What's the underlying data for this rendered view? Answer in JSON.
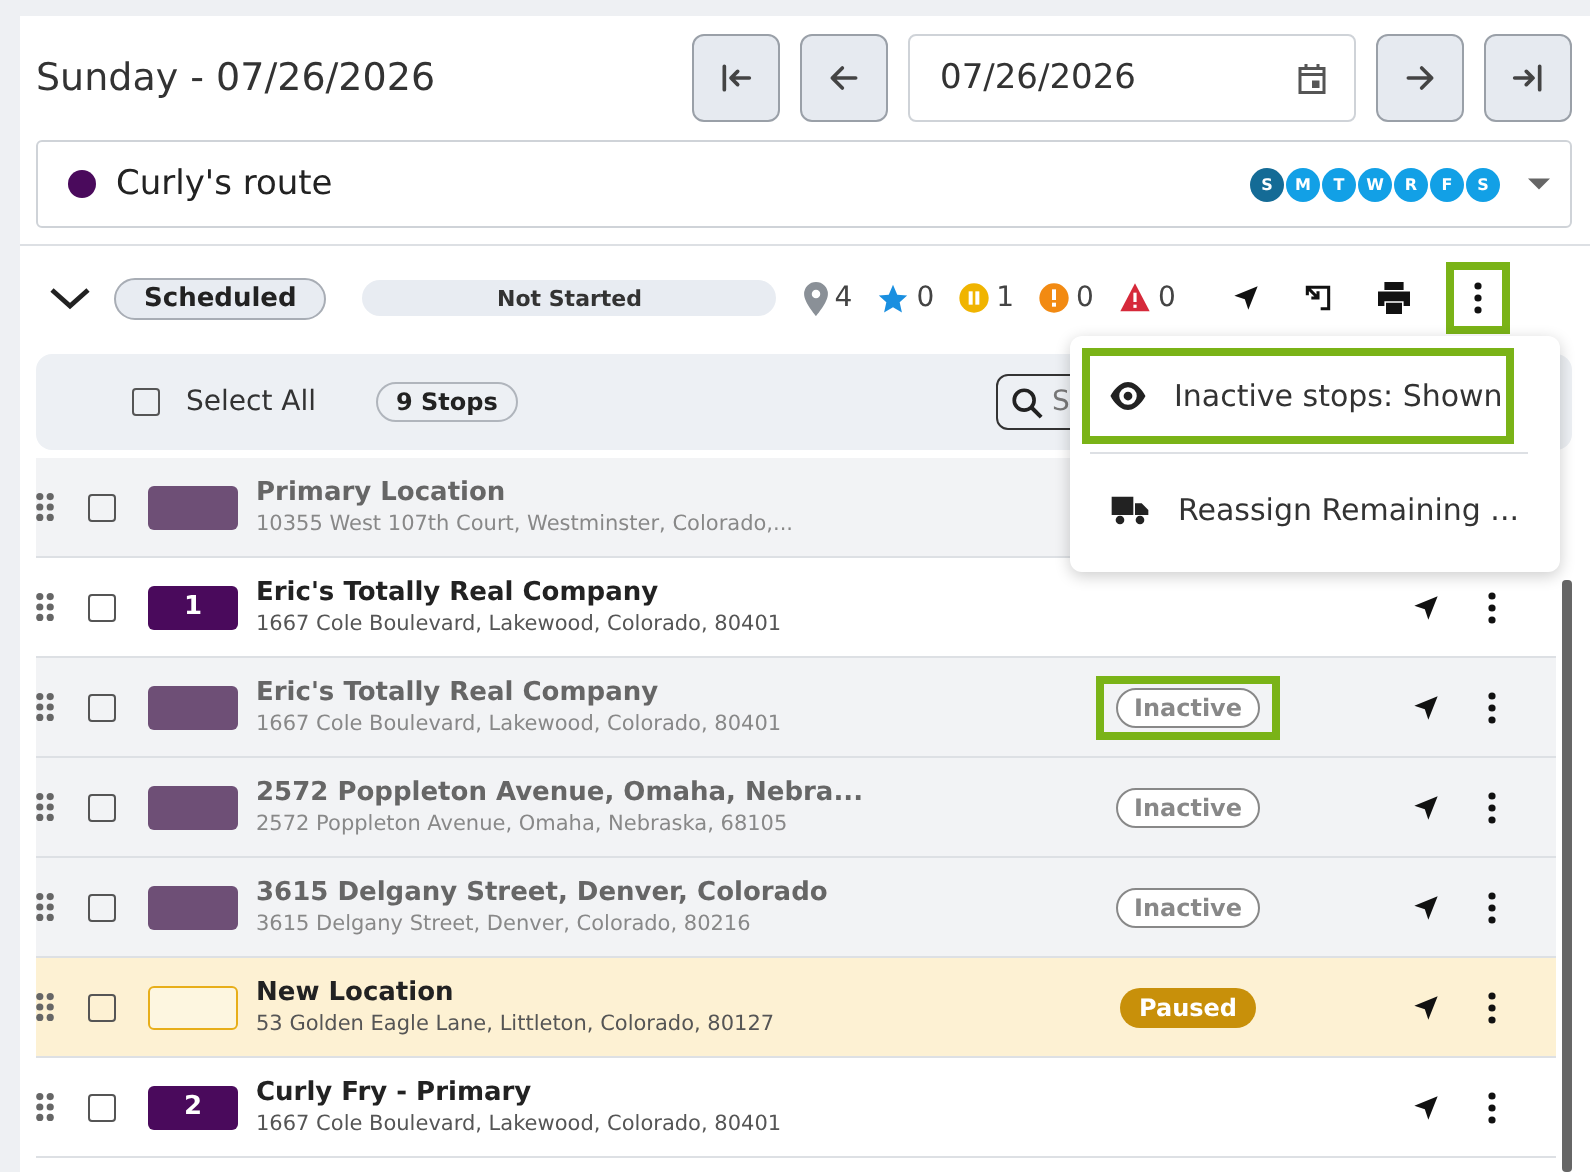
{
  "header": {
    "title": "Sunday - 07/26/2026",
    "date_value": "07/26/2026"
  },
  "route": {
    "name": "Curly's route",
    "color": "#4a0a5c",
    "days": [
      {
        "label": "S",
        "selected": true
      },
      {
        "label": "M",
        "selected": false
      },
      {
        "label": "T",
        "selected": false
      },
      {
        "label": "W",
        "selected": false
      },
      {
        "label": "R",
        "selected": false
      },
      {
        "label": "F",
        "selected": false
      },
      {
        "label": "S",
        "selected": false
      }
    ]
  },
  "toolbar": {
    "expanded": true,
    "status": "Scheduled",
    "progress_label": "Not Started",
    "more_highlighted": true,
    "stats": [
      {
        "kind": "pin",
        "count": "4"
      },
      {
        "kind": "star",
        "count": "0"
      },
      {
        "kind": "paused",
        "count": "1"
      },
      {
        "kind": "alert",
        "count": "0"
      },
      {
        "kind": "warning",
        "count": "0"
      }
    ]
  },
  "list_header": {
    "select_all": "Select All",
    "select_all_checked": false,
    "stops_count": "9 Stops",
    "search": {
      "placeholder": "S"
    }
  },
  "menu": {
    "items": [
      {
        "kind": "eye",
        "label": "Inactive stops: Shown",
        "highlighted": true
      },
      {
        "kind": "truck",
        "label": "Reassign Remaining ...",
        "highlighted": false
      }
    ]
  },
  "stops": [
    {
      "kind": "inactive",
      "name": "Primary Location",
      "address": "10355 West 107th Court, Westminster, Colorado,...",
      "checked": false
    },
    {
      "kind": "active",
      "number": "1",
      "name": "Eric's Totally Real Company",
      "address": "1667 Cole Boulevard, Lakewood, Colorado, 80401",
      "checked": false,
      "actions": true
    },
    {
      "kind": "inactive",
      "name": "Eric's Totally Real Company",
      "address": "1667 Cole Boulevard, Lakewood, Colorado, 80401",
      "checked": false,
      "actions": true,
      "status": "Inactive",
      "highlighted": true
    },
    {
      "kind": "inactive",
      "name": "2572 Poppleton Avenue, Omaha, Nebra...",
      "address": "2572 Poppleton Avenue, Omaha, Nebraska, 68105",
      "checked": false,
      "actions": true,
      "status": "Inactive",
      "highlighted": false
    },
    {
      "kind": "inactive",
      "name": "3615 Delgany Street, Denver, Colorado",
      "address": "3615 Delgany Street, Denver, Colorado, 80216",
      "checked": false,
      "actions": true,
      "status": "Inactive",
      "highlighted": false
    },
    {
      "kind": "paused",
      "name": "New Location",
      "address": "53 Golden Eagle Lane, Littleton, Colorado, 80127",
      "checked": false,
      "actions": true,
      "status": "Paused",
      "highlighted": false
    },
    {
      "kind": "active",
      "number": "2",
      "name": "Curly Fry - Primary",
      "address": "1667 Cole Boulevard, Lakewood, Colorado, 80401",
      "checked": false,
      "actions": true
    }
  ]
}
